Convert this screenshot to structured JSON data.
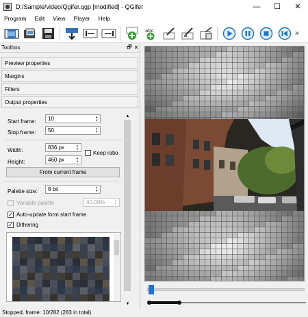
{
  "window": {
    "title": "D:/Sample/video/Qgifer.qgp [modified] - QGifer",
    "minimize_glyph": "—",
    "maximize_glyph": "☐",
    "close_glyph": "✕"
  },
  "menu": [
    "Program",
    "Edit",
    "View",
    "Player",
    "Help"
  ],
  "toolbar": {
    "icons": [
      "load-video-icon",
      "open-project-icon",
      "save-project-icon",
      "extract-gif-icon",
      "set-start-icon",
      "set-end-icon",
      "add-object-icon",
      "add-text-icon",
      "edit-object-icon",
      "edit-object-2-icon",
      "crop-icon",
      "play-icon",
      "pause-icon",
      "stop-icon",
      "previous-icon"
    ],
    "more": "»"
  },
  "toolbox": {
    "title": "Toolbox",
    "float_glyph": "🗗",
    "close_glyph": "✕",
    "sections": [
      "Preview properties",
      "Margins",
      "Filters",
      "Output properties"
    ]
  },
  "output": {
    "start_frame_label": "Start frame:",
    "start_frame_value": "10",
    "stop_frame_label": "Stop frame:",
    "stop_frame_value": "50",
    "width_label": "Width:",
    "width_value": "836 px",
    "height_label": "Height:",
    "height_value": "460 px",
    "keep_ratio_label": "Keep ratio",
    "keep_ratio_checked": false,
    "from_current_frame": "From current frame",
    "palette_size_label": "Palette size:",
    "palette_size_value": "8 bit",
    "variable_palette_label": "Variable palette",
    "variable_palette_checked": false,
    "variable_palette_value": "40.00%",
    "auto_update_label": "Auto-update form start frame",
    "auto_update_checked": true,
    "dithering_label": "Dithering",
    "dithering_checked": true
  },
  "status": "Stopped, frame: 10/282 (283 in total)",
  "player": {
    "position_fraction": 0.04,
    "range_start_fraction": 0.0,
    "range_end_fraction": 0.2
  },
  "colors": {
    "accent_blue": "#1976d2",
    "add_green": "#2e9e2e"
  }
}
